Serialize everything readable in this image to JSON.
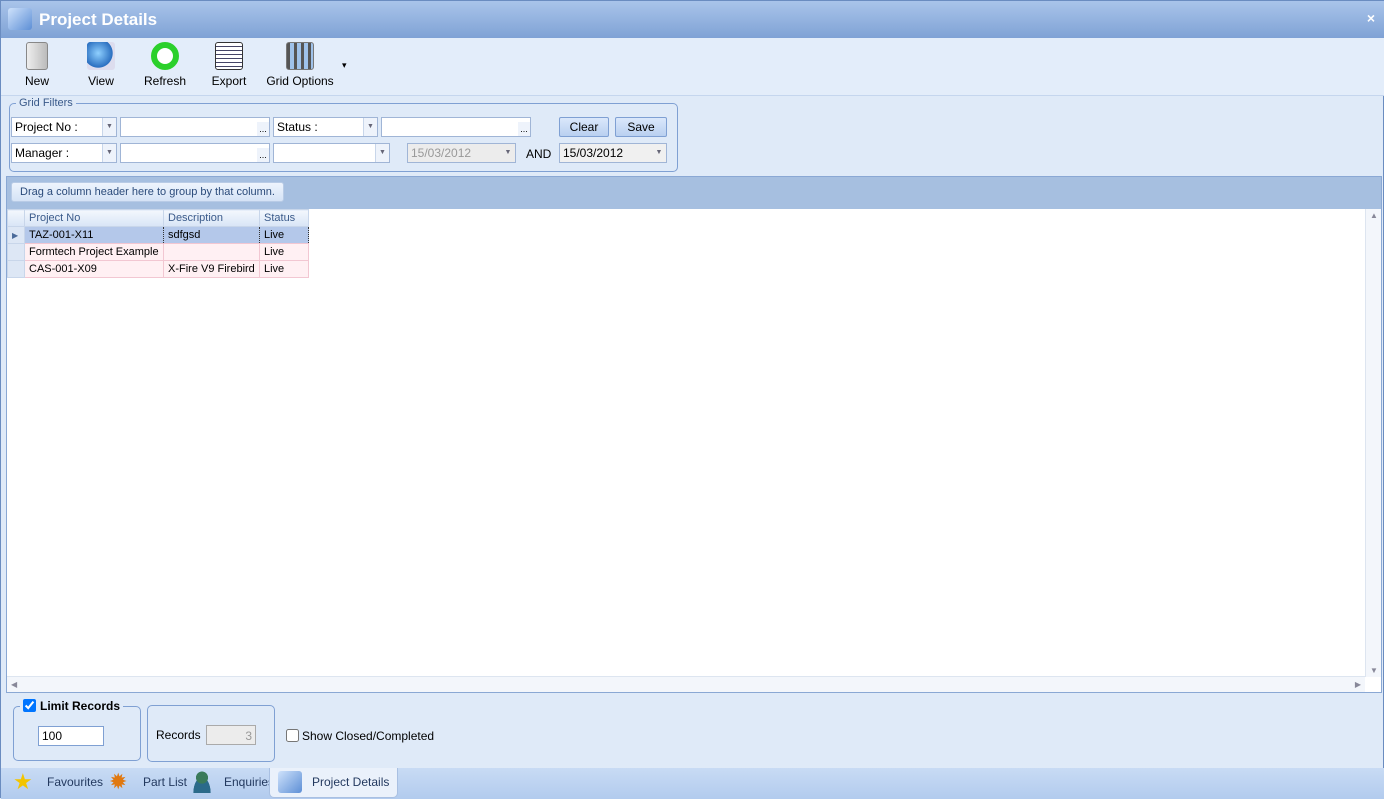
{
  "window": {
    "title": "Project Details",
    "close": "×"
  },
  "toolbar": {
    "items": [
      {
        "label": "New",
        "icon": "new-document-icon"
      },
      {
        "label": "View",
        "icon": "view-magnifier-icon"
      },
      {
        "label": "Refresh",
        "icon": "refresh-icon"
      },
      {
        "label": "Export",
        "icon": "export-icon"
      },
      {
        "label": "Grid Options",
        "icon": "grid-options-icon"
      }
    ],
    "more": "▾"
  },
  "filters": {
    "legend": "Grid Filters",
    "field1": "Project No :",
    "value1": "",
    "field2": "Status :",
    "value2": "",
    "field3": "Manager :",
    "value3": "",
    "field4": "",
    "date_from": "15/03/2012",
    "and_label": "AND",
    "date_to": "15/03/2012",
    "ellipsis": "...",
    "clear": "Clear",
    "save": "Save"
  },
  "grid": {
    "group_hint": "Drag a column header here to group by that column.",
    "columns": [
      "Project No",
      "Description",
      "Status"
    ],
    "rows": [
      [
        "TAZ-001-X11",
        "sdfgsd",
        "Live"
      ],
      [
        "Formtech Project Example",
        "",
        "Live"
      ],
      [
        "CAS-001-X09",
        "X-Fire V9 Firebird",
        "Live"
      ]
    ]
  },
  "bottom": {
    "limit_label": "Limit Records",
    "limit_checked": true,
    "limit_value": "100",
    "records_label": "Records",
    "records_value": "3",
    "show_closed_label": "Show Closed/Completed",
    "show_closed_checked": false
  },
  "tabs": [
    {
      "label": "Favourites"
    },
    {
      "label": "Part List"
    },
    {
      "label": "Enquiries"
    },
    {
      "label": "Project Details",
      "active": true
    }
  ],
  "colors": {
    "title_bar": "#7fa2d5",
    "selected_row": "#b4c8ea",
    "alt_row": "#fff0f3"
  }
}
